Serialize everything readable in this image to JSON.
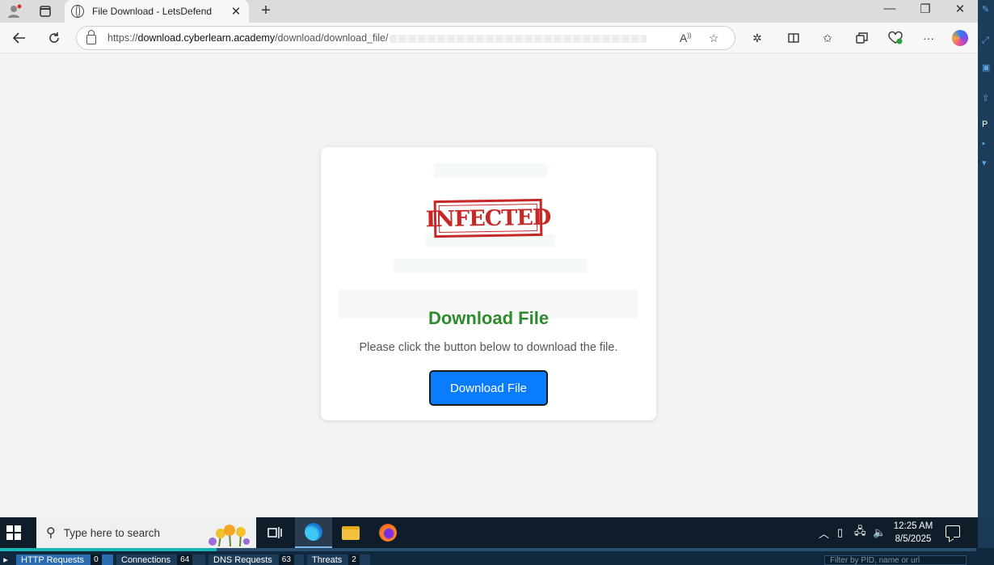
{
  "browser": {
    "tab": {
      "title": "File Download - LetsDefend",
      "close": "✕"
    },
    "new_tab": "+",
    "window_controls": {
      "minimize": "—",
      "restore": "❐",
      "close": "✕"
    },
    "address": {
      "prefix": "https://",
      "host": "download.cyberlearn.academy",
      "path": "/download/download_file/"
    },
    "icons": [
      "back-arrow-icon",
      "refresh-icon",
      "lock-icon",
      "read-aloud-icon",
      "favorite-star-icon",
      "extensions-icon",
      "split-screen-icon",
      "favorites-icon",
      "collections-icon",
      "browser-essentials-icon",
      "more-icon",
      "copilot-icon"
    ]
  },
  "page": {
    "stamp": "INFECTED",
    "title": "Download File",
    "message": "Please click the button below to download the file.",
    "button": "Download File",
    "colors": {
      "title": "#2e8b2e",
      "button": "#0a7cff",
      "stamp": "#c62828"
    }
  },
  "taskbar": {
    "search_placeholder": "Type here to search",
    "time": "12:25 AM",
    "date": "8/5/2025"
  },
  "monitor": {
    "tabs": [
      {
        "label": "HTTP Requests",
        "count": "0"
      },
      {
        "label": "Connections",
        "count": "64"
      },
      {
        "label": "DNS Requests",
        "count": "63"
      },
      {
        "label": "Threats",
        "count": "2"
      }
    ],
    "filter_placeholder": "Filter by PID, name or url"
  }
}
